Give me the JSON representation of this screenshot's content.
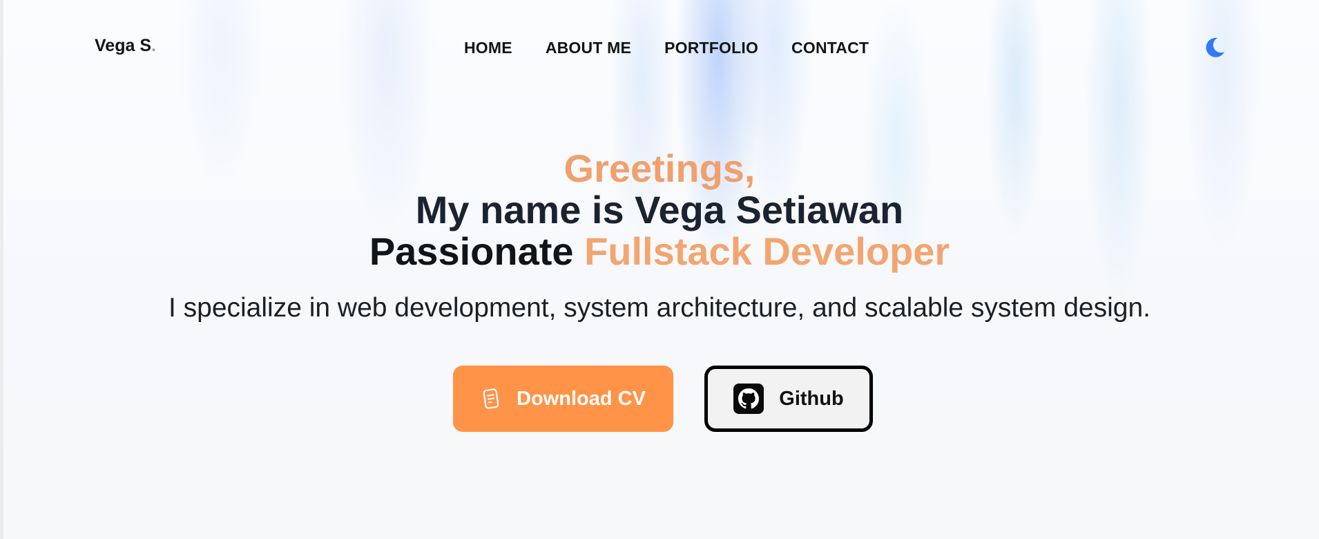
{
  "header": {
    "brand": "Vega S",
    "brand_dot": ".",
    "nav": [
      {
        "label": "HOME"
      },
      {
        "label": "ABOUT ME"
      },
      {
        "label": "PORTFOLIO"
      },
      {
        "label": "CONTACT"
      }
    ],
    "theme_toggle_icon": "moon-icon"
  },
  "hero": {
    "greeting": "Greetings,",
    "name_line": "My name is Vega Setiawan",
    "role_prefix": "Passionate",
    "role_highlight": "Fullstack Developer",
    "tagline": "I specialize in web development, system architecture, and scalable system design."
  },
  "actions": {
    "download_cv": {
      "label": "Download CV",
      "icon": "document-icon"
    },
    "github": {
      "label": "Github",
      "icon": "github-icon"
    }
  },
  "colors": {
    "accent": "#ff9347",
    "greeting": "#f0a06c",
    "moon": "#2f7bf6",
    "text_dark": "#141414"
  }
}
